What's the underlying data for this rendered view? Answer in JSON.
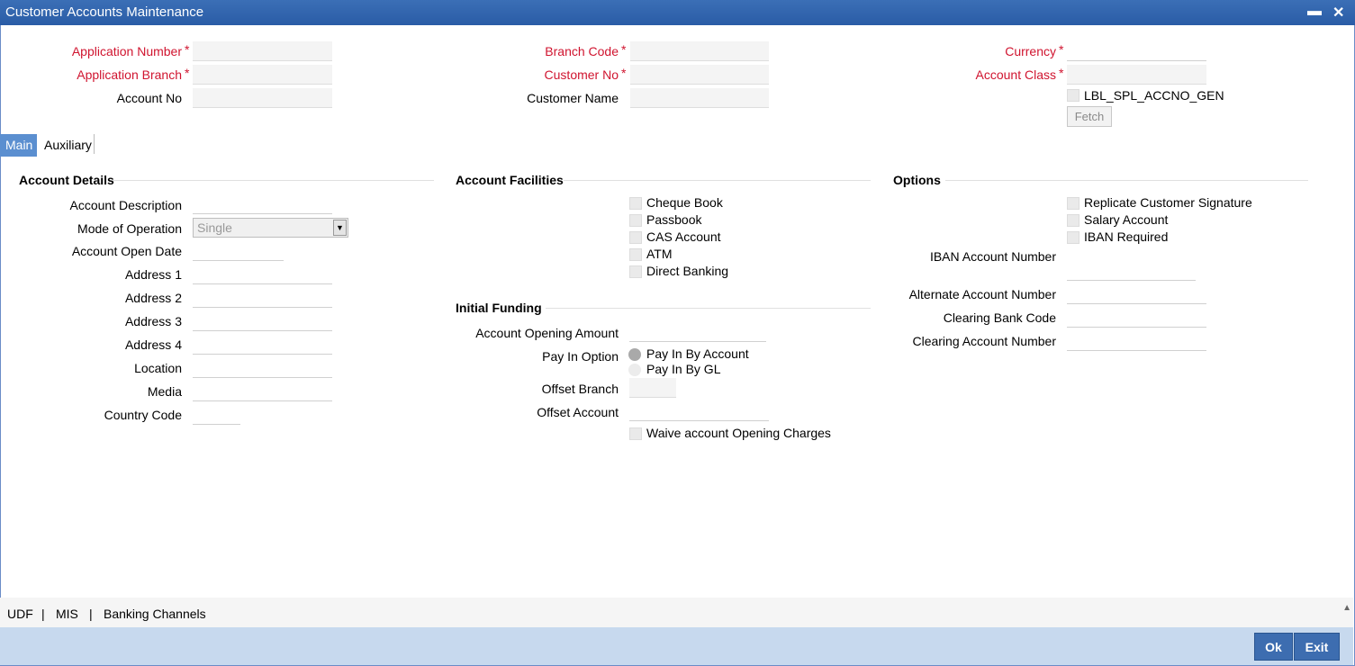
{
  "window": {
    "title": "Customer Accounts Maintenance",
    "minimize": "▬",
    "close": "✕"
  },
  "header": {
    "application_number": "Application Number",
    "application_branch": "Application Branch",
    "account_no": "Account No",
    "branch_code": "Branch Code",
    "customer_no": "Customer No",
    "customer_name": "Customer Name",
    "currency": "Currency",
    "account_class": "Account Class",
    "spl_accno": "LBL_SPL_ACCNO_GEN",
    "fetch": "Fetch",
    "required_mark": "*"
  },
  "tabs": [
    {
      "label": "Main"
    },
    {
      "label": "Auxiliary"
    }
  ],
  "account_details": {
    "title": "Account Details",
    "account_description": "Account Description",
    "mode_of_operation": "Mode of Operation",
    "mode_value": "Single",
    "account_open_date": "Account Open Date",
    "address1": "Address 1",
    "address2": "Address 2",
    "address3": "Address 3",
    "address4": "Address 4",
    "location": "Location",
    "media": "Media",
    "country_code": "Country Code"
  },
  "account_facilities": {
    "title": "Account Facilities",
    "items": [
      "Cheque Book",
      "Passbook",
      "CAS Account",
      "ATM",
      "Direct Banking"
    ]
  },
  "initial_funding": {
    "title": "Initial Funding",
    "opening_amount": "Account Opening Amount",
    "pay_in_option": "Pay In Option",
    "pay_in_by_account": "Pay In By Account",
    "pay_in_by_gl": "Pay In By GL",
    "offset_branch": "Offset Branch",
    "offset_account": "Offset Account",
    "waive_charges": "Waive account Opening Charges"
  },
  "options": {
    "title": "Options",
    "replicate_signature": "Replicate Customer Signature",
    "salary_account": "Salary Account",
    "iban_required": "IBAN Required",
    "iban_account_number": "IBAN Account Number",
    "alternate_account_number": "Alternate Account Number",
    "clearing_bank_code": "Clearing Bank Code",
    "clearing_account_number": "Clearing Account Number"
  },
  "footer": {
    "links": [
      "UDF",
      "MIS",
      "Banking Channels"
    ],
    "separator": "|",
    "ok": "Ok",
    "exit": "Exit",
    "scroll_up": "▲"
  }
}
